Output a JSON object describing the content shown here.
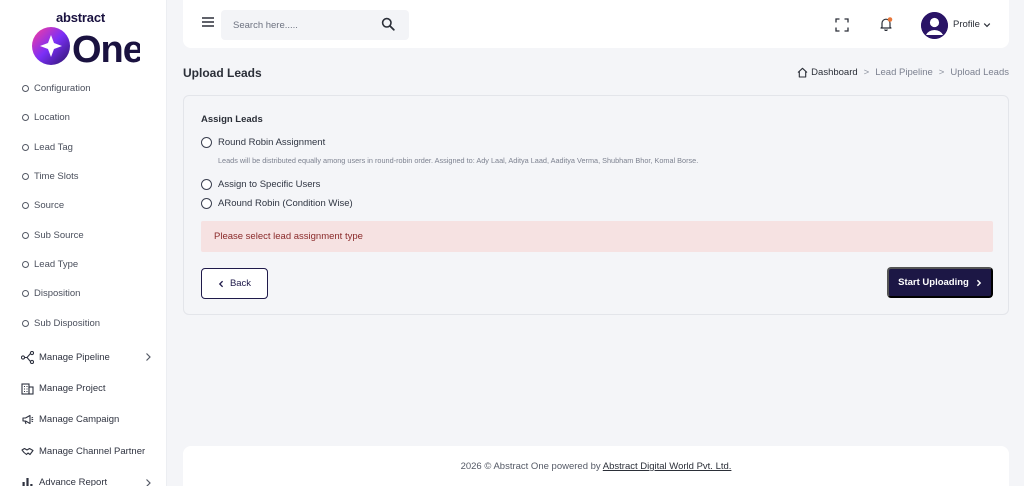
{
  "brand": {
    "top": "abstract",
    "bottom": "One"
  },
  "sidebar": {
    "sub_items": [
      {
        "label": "Configuration"
      },
      {
        "label": "Location"
      },
      {
        "label": "Lead Tag"
      },
      {
        "label": "Time Slots"
      },
      {
        "label": "Source"
      },
      {
        "label": "Sub Source"
      },
      {
        "label": "Lead Type"
      },
      {
        "label": "Disposition"
      },
      {
        "label": "Sub Disposition"
      }
    ],
    "main_items": [
      {
        "label": "Manage Pipeline",
        "icon": "pipeline-icon",
        "has_children": true
      },
      {
        "label": "Manage Project",
        "icon": "building-icon",
        "has_children": false
      },
      {
        "label": "Manage Campaign",
        "icon": "megaphone-icon",
        "has_children": false
      },
      {
        "label": "Manage Channel Partner",
        "icon": "handshake-icon",
        "has_children": false
      },
      {
        "label": "Advance Report",
        "icon": "bar-chart-icon",
        "has_children": true
      }
    ]
  },
  "header": {
    "search_placeholder": "Search here.....",
    "profile_label": "Profile"
  },
  "page": {
    "title": "Upload Leads",
    "breadcrumb": [
      "Dashboard",
      "Lead Pipeline",
      "Upload Leads"
    ]
  },
  "form": {
    "section_label": "Assign Leads",
    "options": [
      {
        "label": "Round Robin Assignment"
      },
      {
        "label": "Assign to Specific Users"
      },
      {
        "label": "ARound Robin (Condition Wise)"
      }
    ],
    "round_robin_help": "Leads will be distributed equally among users in round-robin order. Assigned to: Ady Laal, Aditya Laad, Aaditya Verma, Shubham Bhor, Komal Borse.",
    "error_message": "Please select lead assignment type",
    "back_label": "Back",
    "start_label": "Start Uploading"
  },
  "footer": {
    "prefix": "2026 © Abstract One powered by ",
    "company": "Abstract Digital World Pvt. Ltd."
  },
  "colors": {
    "accent": "#1c1745",
    "alert_bg": "#f6e2e2",
    "alert_text": "#8a2a2a",
    "notification_dot": "#e8773a"
  }
}
